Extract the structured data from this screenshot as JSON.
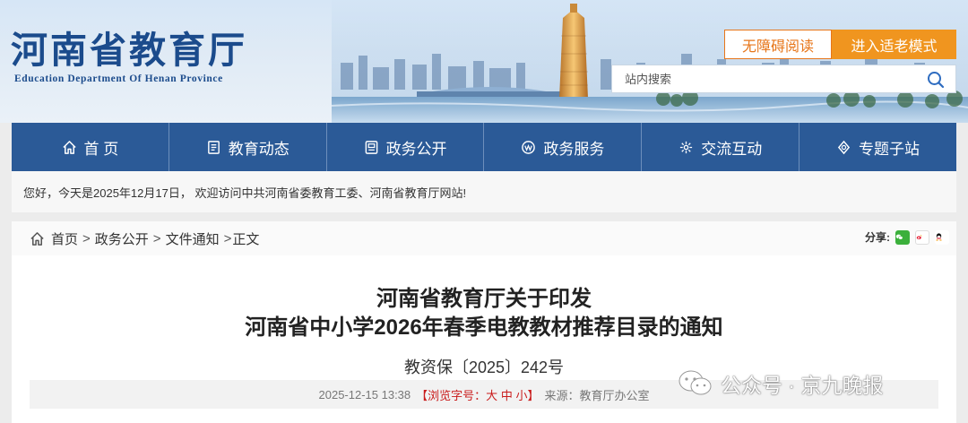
{
  "header": {
    "logo_cn": "河南省教育厅",
    "logo_en": "Education Department Of Henan Province",
    "barrier_free_label": "无障碍阅读",
    "elder_mode_label": "进入适老模式",
    "search_placeholder": "站内搜索"
  },
  "nav": {
    "items": [
      {
        "label": "首 页",
        "icon": "home-icon"
      },
      {
        "label": "教育动态",
        "icon": "news-icon"
      },
      {
        "label": "政务公开",
        "icon": "document-icon"
      },
      {
        "label": "政务服务",
        "icon": "service-icon"
      },
      {
        "label": "交流互动",
        "icon": "chat-icon"
      },
      {
        "label": "专题子站",
        "icon": "topic-icon"
      }
    ]
  },
  "welcome": {
    "text": "您好，今天是2025年12月17日， 欢迎访问中共河南省委教育工委、河南省教育厅网站!"
  },
  "breadcrumb": {
    "items": [
      "首页",
      "政务公开",
      "文件通知",
      "正文"
    ],
    "separator": ">",
    "share_label": "分享:"
  },
  "article": {
    "title_line1": "河南省教育厅关于印发",
    "title_line2": "河南省中小学2026年春季电教教材推荐目录的通知",
    "doc_number": "教资保〔2025〕242号",
    "date": "2025-12-15 13:38",
    "font_size_label": "【浏览字号：",
    "font_size_options": [
      "大",
      "中",
      "小"
    ],
    "font_size_end": "】",
    "source": "来源：教育厅办公室"
  },
  "watermark": {
    "text": "公众号 · 京九晚报"
  },
  "colors": {
    "nav_bg": "#2b5a97",
    "accent_orange": "#f0951f",
    "logo_blue": "#1b4b8c",
    "font_size_red": "#c91c1c"
  }
}
